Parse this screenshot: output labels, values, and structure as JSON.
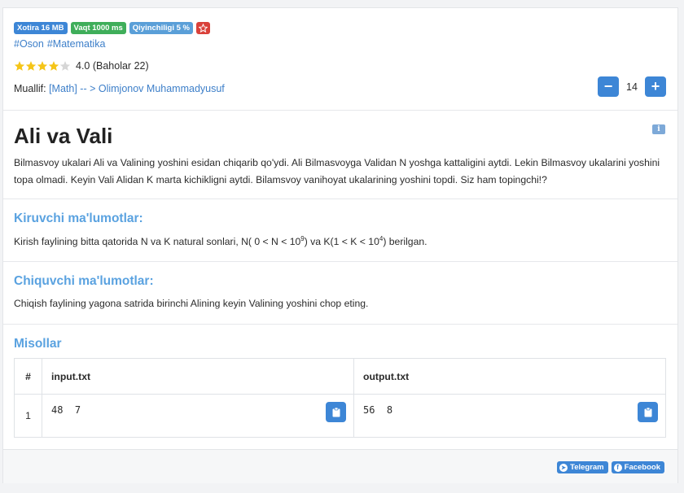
{
  "badges": {
    "memory": "Xotira 16 MB",
    "time": "Vaqt 1000 ms",
    "difficulty": "Qiyinchiligi 5 %"
  },
  "tags": [
    "#Oson",
    "#Matematika"
  ],
  "rating": {
    "value": 4,
    "max": 5,
    "text": "4.0 (Baholar 22)"
  },
  "author": {
    "label": "Muallif:",
    "link": "[Math] -- > Olimjonov Muhammadyusuf"
  },
  "stepper": {
    "value": "14",
    "minus": "−",
    "plus": "+"
  },
  "problem": {
    "title": "Ali va Vali",
    "statement": "Bilmasvoy ukalari Ali va Valining yoshini esidan chiqarib qo'ydi. Ali Bilmasvoyga Validan N yoshga kattaligini aytdi. Lekin Bilmasvoy ukalarini yoshini topa olmadi. Keyin Vali Alidan K marta kichikligni aytdi. Bilamsvoy vanihoyat ukalarining yoshini topdi. Siz ham topingchi!?"
  },
  "input_section": {
    "heading": "Kiruvchi ma'lumotlar:",
    "text_before": "Kirish faylining bitta qatorida N va K natural sonlari, N( 0 < N < 10",
    "sup1": "9",
    "text_mid": ") va K(1 < K < 10",
    "sup2": "4",
    "text_after": ") berilgan."
  },
  "output_section": {
    "heading": "Chiquvchi ma'lumotlar:",
    "text": "Chiqish faylining yagona satrida birinchi Alining keyin Valining yoshini chop eting."
  },
  "examples": {
    "heading": "Misollar",
    "columns": [
      "#",
      "input.txt",
      "output.txt"
    ],
    "rows": [
      {
        "num": "1",
        "input": "48  7",
        "output": "56  8"
      }
    ]
  },
  "share": {
    "telegram": "Telegram",
    "facebook": "Facebook"
  },
  "colors": {
    "primary": "#3d86d6",
    "success": "#3fae5a",
    "danger": "#d9413a",
    "star": "#f5c518"
  }
}
